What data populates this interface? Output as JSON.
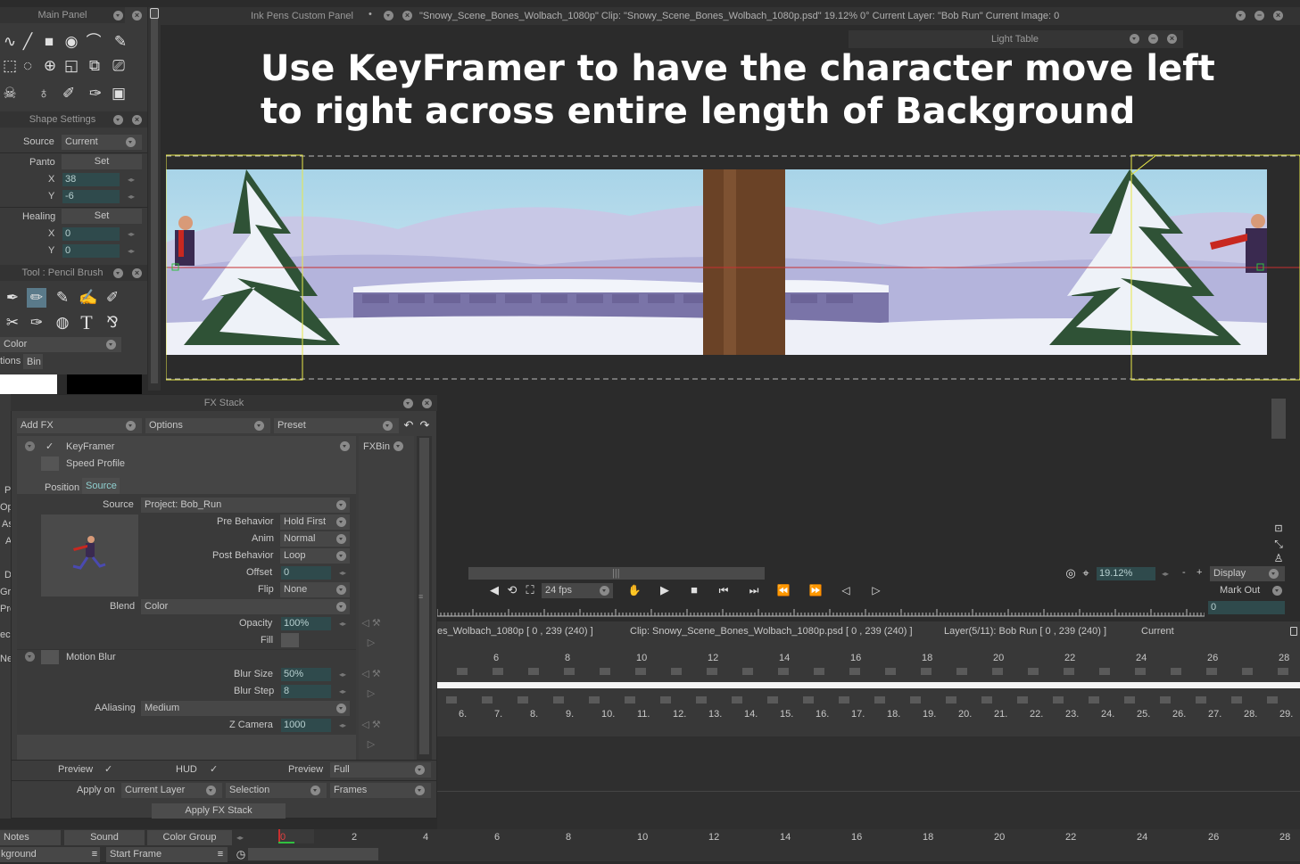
{
  "main_panel": {
    "title": "Main Panel",
    "shape_settings": "Shape Settings",
    "source_label": "Source",
    "source_value": "Current",
    "panto_label": "Panto",
    "panto_btn": "Set",
    "panto_x_label": "X",
    "panto_x": "38",
    "panto_y_label": "Y",
    "panto_y": "-6",
    "healing_label": "Healing",
    "healing_btn": "Set",
    "healing_x_label": "X",
    "healing_x": "0",
    "healing_y_label": "Y",
    "healing_y": "0",
    "tool_title": "Tool : Pencil Brush",
    "color_label": "Color",
    "tab_tions": "tions",
    "tab_bin": "Bin"
  },
  "ink_panel": {
    "title": "Ink Pens Custom Panel"
  },
  "viewer": {
    "clip_info": "\"Snowy_Scene_Bones_Wolbach_1080p\"  Clip: \"Snowy_Scene_Bones_Wolbach_1080p.psd\"   19.12%   0°  Current Layer: \"Bob Run\"  Current Image: 0",
    "light_table": "Light Table",
    "instruction_line1": "Use KeyFramer to have the character move left",
    "instruction_line2": "to right across entire length of Background",
    "zoom": "19.12%",
    "display": "Display",
    "fps": "24 fps",
    "mark_out": "Mark Out",
    "mark_out_value": "0"
  },
  "fx_stack": {
    "title": "FX Stack",
    "add_fx": "Add FX",
    "options": "Options",
    "preset": "Preset",
    "keyframer": "KeyFramer",
    "speed_profile": "Speed Profile",
    "tab_position": "Position",
    "tab_source": "Source",
    "fxbin": "FXBin",
    "source_label": "Source",
    "source_value": "Project: Bob_Run",
    "pre_behavior_label": "Pre Behavior",
    "pre_behavior": "Hold First",
    "anim_label": "Anim",
    "anim": "Normal",
    "post_behavior_label": "Post Behavior",
    "post_behavior": "Loop",
    "offset_label": "Offset",
    "offset": "0",
    "flip_label": "Flip",
    "flip": "None",
    "blend_label": "Blend",
    "blend": "Color",
    "opacity_label": "Opacity",
    "opacity": "100%",
    "fill_label": "Fill",
    "motion_blur": "Motion Blur",
    "blur_size_label": "Blur Size",
    "blur_size": "50%",
    "blur_step_label": "Blur Step",
    "blur_step": "8",
    "aaliasing_label": "AAliasing",
    "aaliasing": "Medium",
    "zcamera_label": "Z Camera",
    "zcamera": "1000",
    "preview_label": "Preview",
    "hud_label": "HUD",
    "preview2_label": "Preview",
    "preview2_value": "Full",
    "apply_on_label": "Apply on",
    "apply_on": "Current Layer",
    "selection": "Selection",
    "frames": "Frames",
    "apply_btn": "Apply FX Stack"
  },
  "timeline": {
    "clip1": "es_Wolbach_1080p [ 0 , 239  (240) ]",
    "clip2": "Clip: Snowy_Scene_Bones_Wolbach_1080p.psd [ 0 , 239  (240) ]",
    "layer": "Layer(5/11): Bob Run [ 0 , 239  (240) ]",
    "current": "Current",
    "top_ticks": [
      "6",
      "8",
      "10",
      "12",
      "14",
      "16",
      "18",
      "20",
      "22",
      "24",
      "26",
      "28"
    ],
    "frame_numbers": [
      "6.",
      "7.",
      "8.",
      "9.",
      "10.",
      "11.",
      "12.",
      "13.",
      "14.",
      "15.",
      "16.",
      "17.",
      "18.",
      "19.",
      "20.",
      "21.",
      "22.",
      "23.",
      "24.",
      "25.",
      "26.",
      "27.",
      "28.",
      "29."
    ],
    "bottom_ticks": [
      "0",
      "2",
      "4",
      "6",
      "8",
      "10",
      "12",
      "14",
      "16",
      "18",
      "20",
      "22",
      "24",
      "26",
      "28"
    ],
    "notes": "Notes",
    "sound": "Sound",
    "color_group": "Color Group",
    "kground": "kground",
    "start_frame": "Start Frame"
  },
  "left_edge_letters": [
    "P",
    "Op",
    "As",
    "A",
    "D",
    "Gra",
    "Pre",
    "ec",
    "Ne"
  ],
  "colors": {
    "accent_cyan": "#2f4a4c",
    "guide_yellow": "#e8e84a",
    "guide_red": "#c83030",
    "panel": "#3c3c3c"
  }
}
